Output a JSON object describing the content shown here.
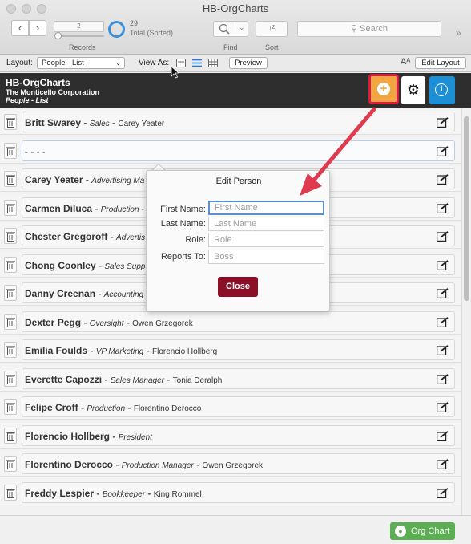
{
  "window": {
    "title": "HB-OrgCharts"
  },
  "toolbar": {
    "record_current": "2",
    "record_count": "29",
    "record_status": "Total (Sorted)",
    "records_label": "Records",
    "find_label": "Find",
    "sort_label": "Sort",
    "sort_glyph": "↓ᶻ",
    "search_placeholder": "Search"
  },
  "layoutbar": {
    "layout_label": "Layout:",
    "layout_value": "People - List",
    "view_as_label": "View As:",
    "preview_label": "Preview",
    "edit_layout_label": "Edit Layout",
    "text_size_glyph": "Aᴬ"
  },
  "header": {
    "app_name": "HB-OrgCharts",
    "company": "The Monticello Corporation",
    "subtitle": "People - List",
    "accent_color": "#f2a640",
    "info_color": "#1d8fd6"
  },
  "rows": [
    {
      "name": "Britt Swarey",
      "role": "Sales",
      "boss": "Carey Yeater"
    },
    {
      "name": "-",
      "role": "",
      "boss": "-"
    },
    {
      "name": "Carey Yeater",
      "role": "Advertising Ma",
      "boss": ""
    },
    {
      "name": "Carmen Diluca",
      "role": "Production -",
      "boss": ""
    },
    {
      "name": "Chester Gregoroff",
      "role": "Advertis",
      "boss": ""
    },
    {
      "name": "Chong Coonley",
      "role": "Sales Supp",
      "boss": ""
    },
    {
      "name": "Danny Creenan",
      "role": "Accounting",
      "boss": ""
    },
    {
      "name": "Dexter Pegg",
      "role": "Oversight",
      "boss": "Owen Grzegorek"
    },
    {
      "name": "Emilia Foulds",
      "role": "VP Marketing",
      "boss": "Florencio Hollberg"
    },
    {
      "name": "Everette Capozzi",
      "role": "Sales Manager",
      "boss": "Tonia Deralph"
    },
    {
      "name": "Felipe Croff",
      "role": "Production",
      "boss": "Florentino Derocco"
    },
    {
      "name": "Florencio Hollberg",
      "role": "President",
      "boss": ""
    },
    {
      "name": "Florentino Derocco",
      "role": "Production Manager",
      "boss": "Owen Grzegorek"
    },
    {
      "name": "Freddy Lespier",
      "role": "Bookkeeper",
      "boss": "King Rommel"
    }
  ],
  "popover": {
    "title": "Edit Person",
    "first_name_label": "First Name:",
    "first_name_placeholder": "First Name",
    "last_name_label": "Last Name:",
    "last_name_placeholder": "Last Name",
    "role_label": "Role:",
    "role_placeholder": "Role",
    "reports_to_label": "Reports To:",
    "reports_to_placeholder": "Boss",
    "close_label": "Close"
  },
  "footer": {
    "org_chart_label": "Org Chart"
  }
}
